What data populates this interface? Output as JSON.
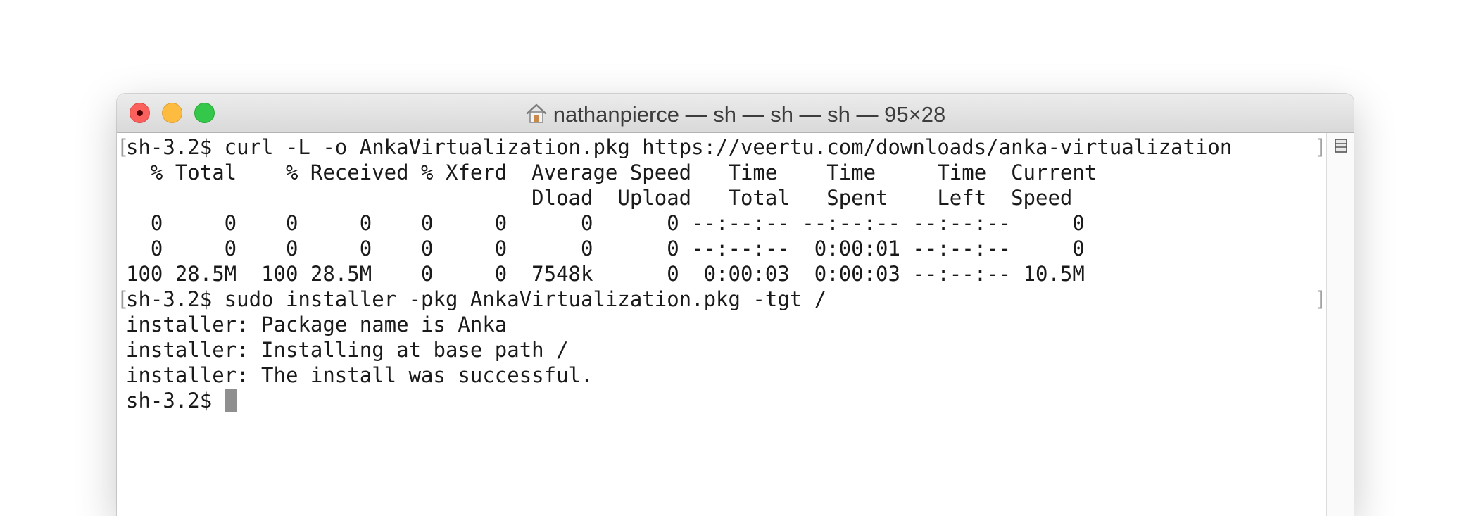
{
  "window": {
    "title": "nathanpierce — sh — sh — sh — 95×28",
    "title_icon": "home-icon"
  },
  "terminal": {
    "lines": [
      "sh-3.2$ curl -L -o AnkaVirtualization.pkg https://veertu.com/downloads/anka-virtualization",
      "  % Total    % Received % Xferd  Average Speed   Time    Time     Time  Current",
      "                                 Dload  Upload   Total   Spent    Left  Speed",
      "  0     0    0     0    0     0      0      0 --:--:-- --:--:-- --:--:--     0",
      "  0     0    0     0    0     0      0      0 --:--:--  0:00:01 --:--:--     0",
      "100 28.5M  100 28.5M    0     0  7548k      0  0:00:03  0:00:03 --:--:-- 10.5M",
      "sh-3.2$ sudo installer -pkg AnkaVirtualization.pkg -tgt /",
      "installer: Package name is Anka",
      "installer: Installing at base path /",
      "installer: The install was successful.",
      "sh-3.2$ "
    ],
    "mark_left": "[",
    "mark_right": "]"
  },
  "colors": {
    "close": "#fc605c",
    "minimize": "#fdbc40",
    "maximize": "#34c84a",
    "cursor": "#8f8f8f"
  }
}
